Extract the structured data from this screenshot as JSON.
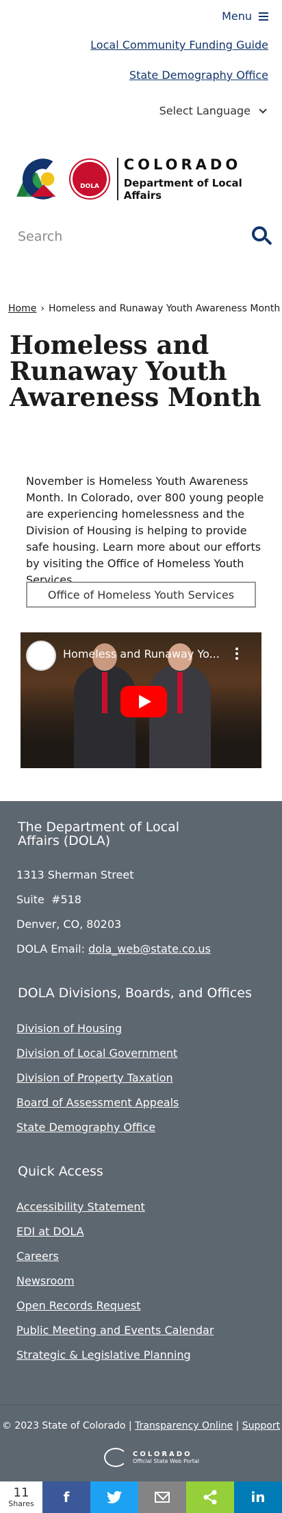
{
  "header": {
    "menu_label": "Menu",
    "links": [
      "Local Community Funding Guide",
      "State Demography Office"
    ],
    "language_label": "Select Language"
  },
  "logo": {
    "dola_badge": "DOLA",
    "line1": "COLORADO",
    "line2": "Department of Local Affairs"
  },
  "search": {
    "placeholder": "Search"
  },
  "breadcrumb": {
    "home": "Home",
    "separator": "›",
    "current": "Homeless and Runaway Youth Awareness Month"
  },
  "page": {
    "title": "Homeless and Runaway Youth Awareness Month",
    "body": "November is Homeless Youth Awareness Month. In Colorado, over 800 young people are experiencing homelessness and the Division of Housing is helping to provide safe housing. Learn more about our efforts by visiting the Office of Homeless Youth Services.",
    "button_label": "Office of Homeless Youth Services"
  },
  "video": {
    "title": "Homeless and Runaway Yo..."
  },
  "footer": {
    "org_heading": "The Department of Local Affairs (DOLA)",
    "address1": "1313 Sherman Street",
    "address2": "Suite  #518",
    "address3": "Denver, CO, 80203",
    "email_label": "DOLA Email:",
    "email": "dola_web@state.co.us",
    "divisions_heading": "DOLA Divisions, Boards, and Offices",
    "divisions": [
      "Division of Housing",
      "Division of Local Government",
      "Division of Property Taxation",
      "Board of Assessment Appeals",
      "State Demography Office"
    ],
    "quick_heading": "Quick Access",
    "quick_links": [
      "Accessibility Statement",
      "EDI at DOLA",
      "Careers",
      "Newsroom",
      "Open Records Request",
      "Public Meeting and Events Calendar",
      "Strategic & Legislative Planning"
    ],
    "copyright": "© 2023 State of Colorado",
    "sep": "|",
    "transparency": "Transparency Online",
    "support": "Support",
    "portal_line1": "COLORADO",
    "portal_line2": "Official State Web Portal"
  },
  "share": {
    "count": "11",
    "count_label": "Shares",
    "facebook": "f",
    "linkedin": "in"
  },
  "colors": {
    "navy": "#10346b",
    "footer": "#5d6770",
    "facebook": "#3b5998",
    "twitter": "#1da1f2",
    "email": "#848484",
    "sharethis": "#95d03a",
    "linkedin": "#007bb5",
    "youtube": "#ff0000"
  }
}
